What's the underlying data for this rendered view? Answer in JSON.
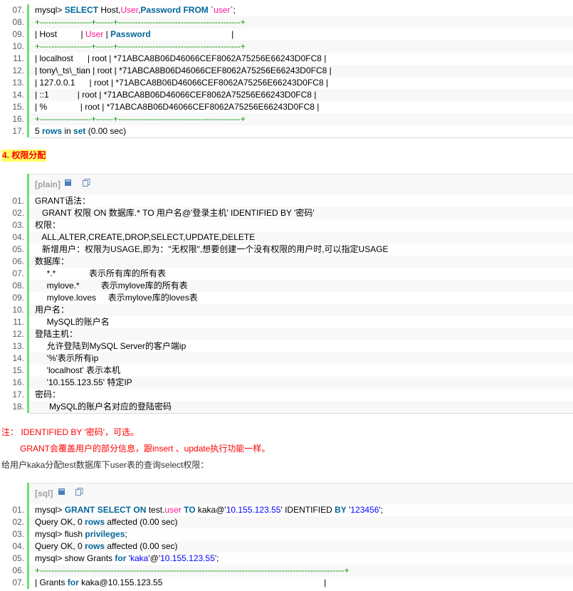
{
  "block1": {
    "lines": [
      {
        "n": "07.",
        "parts": [
          {
            "t": "mysql> ",
            "c": ""
          },
          {
            "t": "SELECT",
            "c": "kw"
          },
          {
            "t": " Host,",
            "c": ""
          },
          {
            "t": "User",
            "c": "fn"
          },
          {
            "t": ",",
            "c": ""
          },
          {
            "t": "Password",
            "c": "kw"
          },
          {
            "t": " ",
            "c": ""
          },
          {
            "t": "FROM",
            "c": "kw"
          },
          {
            "t": " `",
            "c": ""
          },
          {
            "t": "user",
            "c": "fn"
          },
          {
            "t": "`;",
            "c": ""
          }
        ]
      },
      {
        "n": "08.",
        "parts": [
          {
            "t": "+------------------+------+-------------------------------------------+",
            "c": "dash"
          }
        ]
      },
      {
        "n": "09.",
        "parts": [
          {
            "t": "| Host          | ",
            "c": ""
          },
          {
            "t": "User",
            "c": "fn"
          },
          {
            "t": " | ",
            "c": ""
          },
          {
            "t": "Password",
            "c": "kw"
          },
          {
            "t": "                                  |",
            "c": ""
          }
        ]
      },
      {
        "n": "10.",
        "parts": [
          {
            "t": "+------------------+------+-------------------------------------------+",
            "c": "dash"
          }
        ]
      },
      {
        "n": "11.",
        "parts": [
          {
            "t": "| localhost      | root | *71ABCA8B06D46066CEF8062A75256E66243D0FC8 |",
            "c": ""
          }
        ]
      },
      {
        "n": "12.",
        "parts": [
          {
            "t": "| tony\\_ts\\_tian | root | *71ABCA8B06D46066CEF8062A75256E66243D0FC8 |",
            "c": ""
          }
        ]
      },
      {
        "n": "13.",
        "parts": [
          {
            "t": "| 127.0.0.1      | root | *71ABCA8B06D46066CEF8062A75256E66243D0FC8 |",
            "c": ""
          }
        ]
      },
      {
        "n": "14.",
        "parts": [
          {
            "t": "| ::1            | root | *71ABCA8B06D46066CEF8062A75256E66243D0FC8 |",
            "c": ""
          }
        ]
      },
      {
        "n": "15.",
        "parts": [
          {
            "t": "| %              | root | *71ABCA8B06D46066CEF8062A75256E66243D0FC8 |",
            "c": ""
          }
        ]
      },
      {
        "n": "16.",
        "parts": [
          {
            "t": "+------------------+------+-------------------------------------------+",
            "c": "dash"
          }
        ]
      },
      {
        "n": "17.",
        "parts": [
          {
            "t": "5 ",
            "c": ""
          },
          {
            "t": "rows",
            "c": "kw"
          },
          {
            "t": " in ",
            "c": ""
          },
          {
            "t": "set",
            "c": "kw"
          },
          {
            "t": " (0.00 sec)",
            "c": ""
          }
        ]
      }
    ]
  },
  "heading": "4. 权限分配",
  "block2": {
    "lang": "[plain]",
    "lines": [
      {
        "n": "01.",
        "parts": [
          {
            "t": "GRANT语法：",
            "c": ""
          }
        ]
      },
      {
        "n": "02.",
        "parts": [
          {
            "t": "   GRANT 权限 ON 数据库.* TO 用户名@'登录主机' IDENTIFIED BY '密码'",
            "c": ""
          }
        ]
      },
      {
        "n": "03.",
        "parts": [
          {
            "t": "权限：",
            "c": ""
          }
        ]
      },
      {
        "n": "04.",
        "parts": [
          {
            "t": "   ALL,ALTER,CREATE,DROP,SELECT,UPDATE,DELETE",
            "c": ""
          }
        ]
      },
      {
        "n": "05.",
        "parts": [
          {
            "t": "   新增用户：权限为USAGE,即为：\"无权限\",想要创建一个没有权限的用户时,可以指定USAGE",
            "c": ""
          }
        ]
      },
      {
        "n": "06.",
        "parts": [
          {
            "t": "数据库：",
            "c": ""
          }
        ]
      },
      {
        "n": "07.",
        "parts": [
          {
            "t": "     *.*              表示所有库的所有表",
            "c": ""
          }
        ]
      },
      {
        "n": "08.",
        "parts": [
          {
            "t": "     mylove.*         表示mylove库的所有表",
            "c": ""
          }
        ]
      },
      {
        "n": "09.",
        "parts": [
          {
            "t": "     mylove.loves     表示mylove库的loves表",
            "c": ""
          }
        ]
      },
      {
        "n": "10.",
        "parts": [
          {
            "t": "用户名：",
            "c": ""
          }
        ]
      },
      {
        "n": "11.",
        "parts": [
          {
            "t": "     MySQL的账户名",
            "c": ""
          }
        ]
      },
      {
        "n": "12.",
        "parts": [
          {
            "t": "登陆主机：",
            "c": ""
          }
        ]
      },
      {
        "n": "13.",
        "parts": [
          {
            "t": "     允许登陆到MySQL Server的客户端ip",
            "c": ""
          }
        ]
      },
      {
        "n": "14.",
        "parts": [
          {
            "t": "     '%'表示所有ip",
            "c": ""
          }
        ]
      },
      {
        "n": "15.",
        "parts": [
          {
            "t": "     'localhost' 表示本机",
            "c": ""
          }
        ]
      },
      {
        "n": "16.",
        "parts": [
          {
            "t": "     '10.155.123.55' 特定IP",
            "c": ""
          }
        ]
      },
      {
        "n": "17.",
        "parts": [
          {
            "t": "密码：",
            "c": ""
          }
        ]
      },
      {
        "n": "18.",
        "parts": [
          {
            "t": "      MySQL的账户名对应的登陆密码",
            "c": ""
          }
        ]
      }
    ]
  },
  "notes": {
    "n1": "注：  IDENTIFIED BY '密码'，可选。",
    "n2": "GRANT会覆盖用户的部分信息，跟insert 、update执行功能一样。",
    "n3": "给用户kaka分配test数据库下user表的查询select权限："
  },
  "block3": {
    "lang": "[sql]",
    "lines": [
      {
        "n": "01.",
        "parts": [
          {
            "t": "mysql> ",
            "c": ""
          },
          {
            "t": "GRANT",
            "c": "kw"
          },
          {
            "t": " ",
            "c": ""
          },
          {
            "t": "SELECT",
            "c": "kw"
          },
          {
            "t": " ",
            "c": ""
          },
          {
            "t": "ON",
            "c": "kw"
          },
          {
            "t": " test.",
            "c": ""
          },
          {
            "t": "user",
            "c": "fn"
          },
          {
            "t": " ",
            "c": ""
          },
          {
            "t": "TO",
            "c": "kw"
          },
          {
            "t": " kaka@'",
            "c": ""
          },
          {
            "t": "10.155.123.55",
            "c": "str"
          },
          {
            "t": "' IDENTIFIED ",
            "c": ""
          },
          {
            "t": "BY",
            "c": "kw"
          },
          {
            "t": " '",
            "c": ""
          },
          {
            "t": "123456",
            "c": "str"
          },
          {
            "t": "';",
            "c": ""
          }
        ]
      },
      {
        "n": "02.",
        "parts": [
          {
            "t": "Query OK, 0 ",
            "c": ""
          },
          {
            "t": "rows",
            "c": "kw"
          },
          {
            "t": " affected (0.00 sec)",
            "c": ""
          }
        ]
      },
      {
        "n": "03.",
        "parts": [
          {
            "t": "mysql> flush ",
            "c": ""
          },
          {
            "t": "privileges",
            "c": "kw"
          },
          {
            "t": ";",
            "c": ""
          }
        ]
      },
      {
        "n": "04.",
        "parts": [
          {
            "t": "Query OK, 0 ",
            "c": ""
          },
          {
            "t": "rows",
            "c": "kw"
          },
          {
            "t": " affected (0.00 sec)",
            "c": ""
          }
        ]
      },
      {
        "n": "05.",
        "parts": [
          {
            "t": "mysql> show Grants ",
            "c": ""
          },
          {
            "t": "for",
            "c": "kw"
          },
          {
            "t": " '",
            "c": ""
          },
          {
            "t": "kaka",
            "c": "str"
          },
          {
            "t": "'@'",
            "c": ""
          },
          {
            "t": "10.155.123.55",
            "c": "str"
          },
          {
            "t": "';",
            "c": ""
          }
        ]
      },
      {
        "n": "06.",
        "parts": [
          {
            "t": "+-----------------------------------------------------------------------------------------------------------+",
            "c": "dash"
          }
        ]
      },
      {
        "n": "07.",
        "parts": [
          {
            "t": "| Grants ",
            "c": ""
          },
          {
            "t": "for",
            "c": "kw"
          },
          {
            "t": " kaka@10.155.123.55                                                                    |",
            "c": ""
          }
        ]
      }
    ]
  }
}
